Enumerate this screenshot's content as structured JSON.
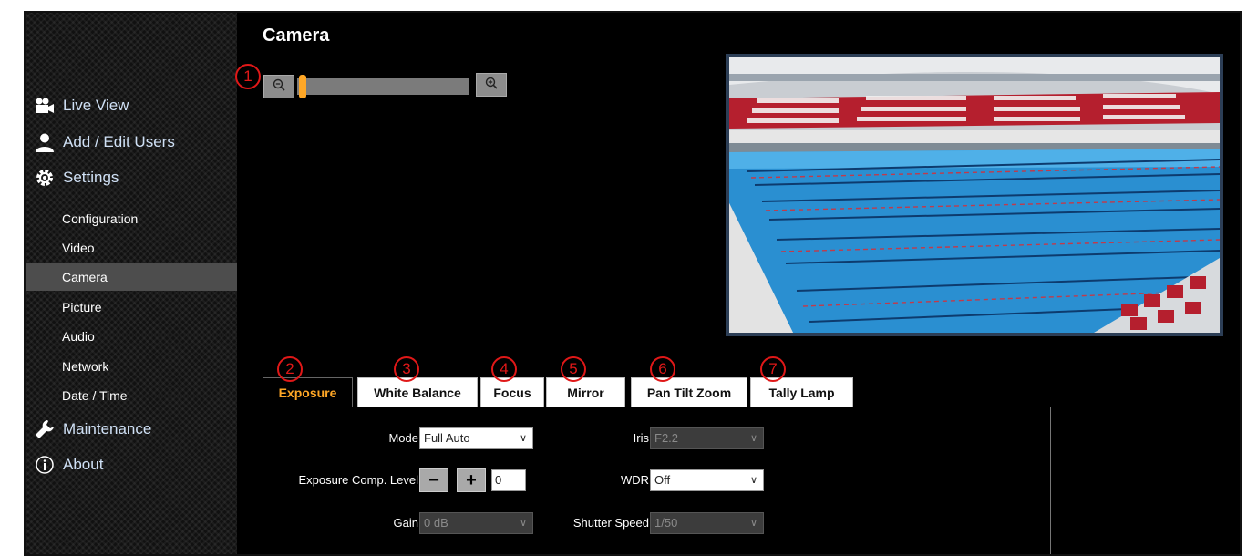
{
  "page": {
    "title": "Camera"
  },
  "sidebar": {
    "main": [
      {
        "label": "Live View",
        "icon": "video-camera-icon"
      },
      {
        "label": "Add / Edit Users",
        "icon": "user-icon"
      },
      {
        "label": "Settings",
        "icon": "gear-icon"
      },
      {
        "label": "Maintenance",
        "icon": "wrench-icon"
      },
      {
        "label": "About",
        "icon": "info-icon"
      }
    ],
    "sub": [
      {
        "label": "Configuration"
      },
      {
        "label": "Video"
      },
      {
        "label": "Camera",
        "active": true
      },
      {
        "label": "Picture"
      },
      {
        "label": "Audio"
      },
      {
        "label": "Network"
      },
      {
        "label": "Date / Time"
      }
    ]
  },
  "zoom": {
    "out_icon": "zoom-out-icon",
    "in_icon": "zoom-in-icon",
    "level": 0.0
  },
  "annotations": [
    "1",
    "2",
    "3",
    "4",
    "5",
    "6",
    "7"
  ],
  "tabs": [
    {
      "label": "Exposure",
      "active": true
    },
    {
      "label": "White Balance"
    },
    {
      "label": "Focus"
    },
    {
      "label": "Mirror"
    },
    {
      "label": "Pan Tilt Zoom"
    },
    {
      "label": "Tally Lamp"
    }
  ],
  "exposure": {
    "mode": {
      "label": "Mode",
      "value": "Full Auto"
    },
    "iris": {
      "label": "Iris",
      "value": "F2.2",
      "disabled": true
    },
    "comp": {
      "label": "Exposure Comp. Level",
      "minus": "−",
      "plus": "+",
      "value": "0"
    },
    "wdr": {
      "label": "WDR",
      "value": "Off"
    },
    "gain": {
      "label": "Gain",
      "value": "0 dB",
      "disabled": true
    },
    "shutter": {
      "label": "Shutter Speed",
      "value": "1/50",
      "disabled": true
    }
  },
  "colors": {
    "accent": "#ffa726",
    "annotation": "#e01818",
    "nav_text": "#cfe0f5"
  }
}
